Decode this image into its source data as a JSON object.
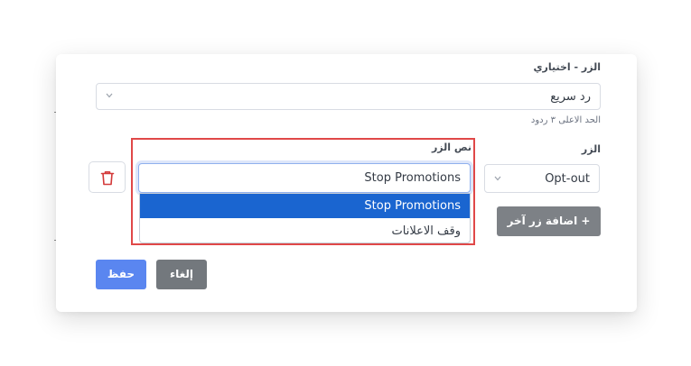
{
  "button_type": {
    "label": "الزر - اختياري",
    "value": "رد سريع",
    "hint": "الحد الاعلى ٣ ردود"
  },
  "button_row": {
    "label": "الزر",
    "type_value": "Opt-out",
    "text_label": "نص الزر",
    "text_value": "Stop Promotions",
    "options": [
      "Stop Promotions",
      "وقف الاعلانات"
    ],
    "selected_option": "Stop Promotions"
  },
  "actions": {
    "add_button": "+ اضافة زر آخر",
    "save": "حفظ",
    "cancel": "إلغاء"
  },
  "colors": {
    "highlight_border": "#e04848",
    "selected_option_bg": "#1a65d0",
    "save_bg": "#5a86f0",
    "cancel_bg": "#73787d",
    "add_bg": "#7d8186",
    "delete_icon": "#d33a3a"
  },
  "icons": {
    "chevron": "chevron-down-icon",
    "delete": "trash-icon",
    "add": "plus-icon"
  }
}
